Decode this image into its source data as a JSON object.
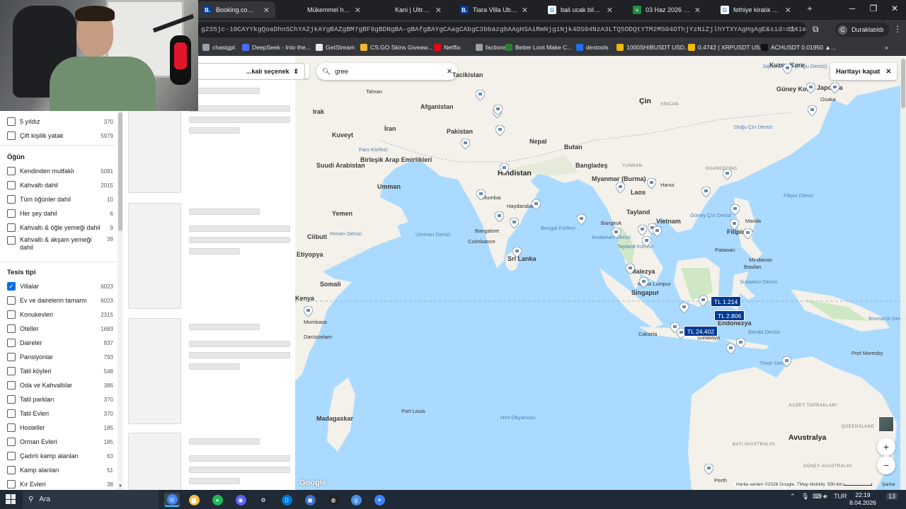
{
  "browser": {
    "tabs": [
      {
        "title": "Booking.com: Hotels",
        "favicon": "booking-icon",
        "active": true
      },
      {
        "title": "Mükemmel her şey d",
        "favicon": "",
        "active": false
      },
      {
        "title": "Kani | Ultra Her Şey D",
        "favicon": "",
        "active": false
      },
      {
        "title": "Tiara Villa Ubud by Di",
        "favicon": "booking-icon",
        "active": false
      },
      {
        "title": "bali ucak bileti - Goo",
        "favicon": "google-icon",
        "active": false
      },
      {
        "title": "03 Haz 2026 İstanbul",
        "favicon": "flight-icon",
        "active": false
      },
      {
        "title": "fethiye kiralık villa - G",
        "favicon": "google-icon",
        "active": false
      }
    ],
    "new_tab": "+",
    "url": "g235jc-10CAYYkgQoaDhnSChYA2jkAYgBAZgBM7gBF8gBDNgBA-gBAfgBAYgCAagCAbgC3bbazgbAAgHSAiRmNjg1Njk4OS04NzA3LTQ5ODQtYTM2MS04OThjYzNiZjlhYTXYAgHgAgE&sid=d141e8a6e4",
    "profile_label": "Duraklatıldı",
    "profile_initial": "C",
    "bookmarks": [
      "chastgpt",
      "DeepSeek - Into the...",
      "GetStream",
      "CS:GO Skins Giveaw...",
      "Netflix",
      "factions",
      "Better Loot Make C...",
      "dextools",
      "1000SHIBUSDT USD...",
      "0.4742 | XRPUSDT US...",
      "ACHUSDT 0.01950 ▲..."
    ],
    "bookmark_colors": [
      "#9aa0a6",
      "#4d6bfe",
      "#e8eaed",
      "#f2b632",
      "#e50914",
      "#9aa0a6",
      "#2e7d32",
      "#1f6feb",
      "#f0b90b",
      "#f0b90b",
      "#111111"
    ]
  },
  "filters": {
    "rows_top": [
      {
        "label": "5 yıldız",
        "count": "370",
        "checked": false
      },
      {
        "label": "Çift kişilik yatak",
        "count": "5979",
        "checked": false
      }
    ],
    "meal_heading": "Öğün",
    "meal": [
      {
        "label": "Kendinden mutfaklı",
        "count": "5081",
        "checked": false
      },
      {
        "label": "Kahvaltı dahil",
        "count": "2015",
        "checked": false
      },
      {
        "label": "Tüm öğünler dahil",
        "count": "10",
        "checked": false
      },
      {
        "label": "Her şey dahil",
        "count": "6",
        "checked": false
      },
      {
        "label": "Kahvaltı & öğle yemeği dahil",
        "count": "9",
        "checked": false
      },
      {
        "label": "Kahvaltı & akşam yemeği dahil",
        "count": "39",
        "checked": false
      }
    ],
    "type_heading": "Tesis tipi",
    "type": [
      {
        "label": "Villalar",
        "count": "6023",
        "checked": true
      },
      {
        "label": "Ev ve dairelerin tamamı",
        "count": "6023",
        "checked": false
      },
      {
        "label": "Konukevleri",
        "count": "2315",
        "checked": false
      },
      {
        "label": "Oteller",
        "count": "1683",
        "checked": false
      },
      {
        "label": "Daireler",
        "count": "937",
        "checked": false
      },
      {
        "label": "Pansiyonlar",
        "count": "793",
        "checked": false
      },
      {
        "label": "Tatil köyleri",
        "count": "548",
        "checked": false
      },
      {
        "label": "Oda ve Kahvaltılar",
        "count": "386",
        "checked": false
      },
      {
        "label": "Tatil parkları",
        "count": "370",
        "checked": false
      },
      {
        "label": "Tatil Evleri",
        "count": "370",
        "checked": false
      },
      {
        "label": "Hosteller",
        "count": "185",
        "checked": false
      },
      {
        "label": "Orman Evleri",
        "count": "185",
        "checked": false
      },
      {
        "label": "Çadırlı kamp alanları",
        "count": "63",
        "checked": false
      },
      {
        "label": "Kamp alanları",
        "count": "51",
        "checked": false
      },
      {
        "label": "Kır Evleri",
        "count": "38",
        "checked": false
      }
    ]
  },
  "results": {
    "sort_label": "...kalı seçenek",
    "card_count": 4
  },
  "map": {
    "search_value": "gree",
    "close_label": "Haritayı kapat",
    "labels_big": [
      "Çin",
      "Hindistan",
      "Avustralya",
      "Güney Kore",
      "Kuzey Kore",
      "Japonya",
      "Afganistan",
      "Pakistan",
      "İran",
      "Irak",
      "Kuveyt",
      "Suudi Arabistan",
      "Birleşik Arap Emirlikleri",
      "Umman",
      "Yemen",
      "Nepal",
      "Butan",
      "Bangladeş",
      "Myanmar (Burma)",
      "Laos",
      "Tayland",
      "Vietnam",
      "Filipinler",
      "Malezya",
      "Singapur",
      "Endonezya",
      "Sri Lanka",
      "Somali",
      "Madagaskar",
      "Tacikistan",
      "Ciibuti",
      "Etiyopya",
      "Kenya"
    ],
    "labels_sea": [
      "Umman Denizi",
      "Bengal Körfezi",
      "Hint Okyanusu",
      "Güney Çin Denizi",
      "Filipin Denizi",
      "Sulawesi Denizi",
      "Banda Denizi",
      "Timor Denizi",
      "Andaman Denizi",
      "Tayland Körfezi",
      "Yemen Denizi",
      "Doğu Çin Denizi",
      "Bismarck Denizi",
      "Fars Körfezi",
      "Japon Denizi (Doğu Denizi)"
    ],
    "labels_city": [
      "Tahran",
      "Mumbai",
      "Haydarabad",
      "Bangalore",
      "Coimbatore",
      "Bangkok",
      "Hanoi",
      "Manila",
      "Kuala Lumpur",
      "Cakarta",
      "Surabaya",
      "Mombasa",
      "Darüsselam",
      "Port Louis",
      "Osaka",
      "Perth",
      "Port Moresby",
      "Mindanao",
      "Palawan",
      "Basilan"
    ],
    "labels_region": [
      "KUZEY TOPRAKLARI",
      "QUEENSLAND",
      "BATI AVUSTRALYA",
      "GÜNEY AVUSTRALYA",
      "YUNNAN",
      "GUANGDONG",
      "SİNCAN"
    ],
    "prices": [
      "TL 1.214",
      "TL 2.806",
      "TL 24.402"
    ],
    "attribution": "Harita verileri ©2026 Google, TMap Mobility",
    "scale": "500 km",
    "terms": "Şartlar",
    "google": "Google",
    "colors": {
      "water": "#aadaff",
      "land": "#f3f1ea",
      "forest": "#cfe7c4",
      "price_bg": "#003b95"
    }
  },
  "taskbar": {
    "search_label": "Ara",
    "apps": [
      "chrome-icon",
      "file-explorer-icon",
      "spotify-icon",
      "discord-icon",
      "steam-icon",
      "vscode-icon",
      "app-icon",
      "obs-icon",
      "g-app-icon",
      "settings-icon"
    ],
    "lang": "TUR",
    "time": "22:19",
    "date": "8.04.2026",
    "notifications": "13"
  }
}
